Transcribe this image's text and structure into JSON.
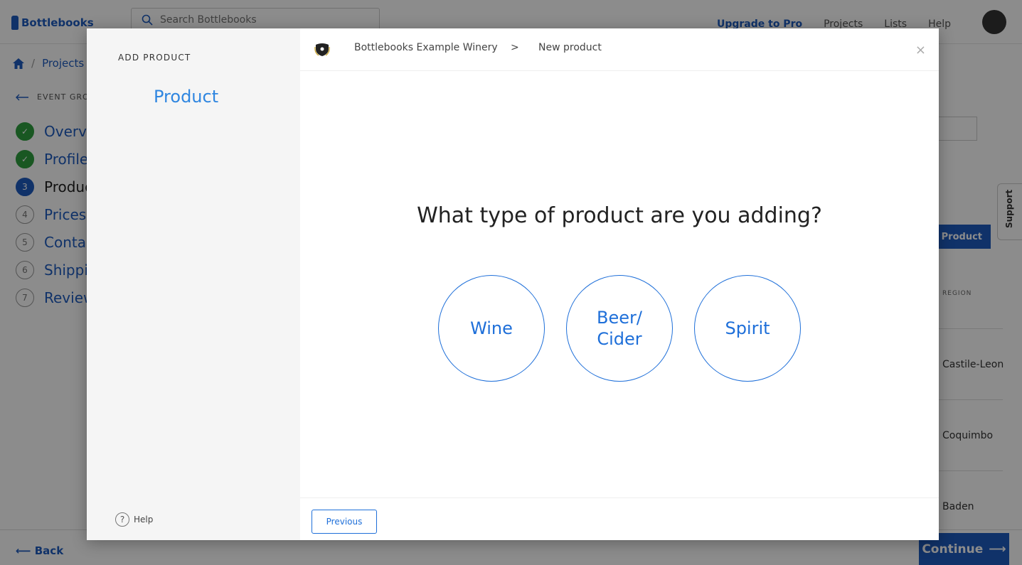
{
  "app": {
    "logo_text": "Bottlebooks",
    "search_placeholder": "Search Bottlebooks",
    "nav": [
      "Upgrade to Pro",
      "Projects",
      "Lists",
      "Help"
    ]
  },
  "breadcrumb": {
    "projects": "Projects",
    "separator": "/"
  },
  "sidebar": {
    "back_label": "EVENT GROU",
    "steps": [
      {
        "number": "✓",
        "label": "Overvi",
        "status": "done"
      },
      {
        "number": "✓",
        "label": "Profile",
        "status": "done"
      },
      {
        "number": "3",
        "label": "Produc",
        "status": "current"
      },
      {
        "number": "4",
        "label": "Prices",
        "status": "todo"
      },
      {
        "number": "5",
        "label": "Contac",
        "status": "todo"
      },
      {
        "number": "6",
        "label": "Shippi",
        "status": "todo"
      },
      {
        "number": "7",
        "label": "Review",
        "status": "todo"
      }
    ]
  },
  "background_right": {
    "add_button": "dd Product",
    "column_header": "REGION",
    "rows": [
      "Castile-Leon",
      "Coquimbo",
      "Baden"
    ]
  },
  "support_tab": "Support",
  "bottom": {
    "back": "Back",
    "continue": "Continue"
  },
  "modal": {
    "side_heading": "ADD PRODUCT",
    "side_step": "Product",
    "help": "Help",
    "header": {
      "org": "Bottlebooks Example Winery",
      "separator": ">",
      "page": "New product",
      "close": "×"
    },
    "question": "What type of product are you adding?",
    "choices": [
      "Wine",
      "Beer/\nCider",
      "Spirit"
    ],
    "previous": "Previous"
  },
  "colors": {
    "brand": "#1e5bbf",
    "accent": "#1e6fd9",
    "done": "#2e9e3e"
  }
}
